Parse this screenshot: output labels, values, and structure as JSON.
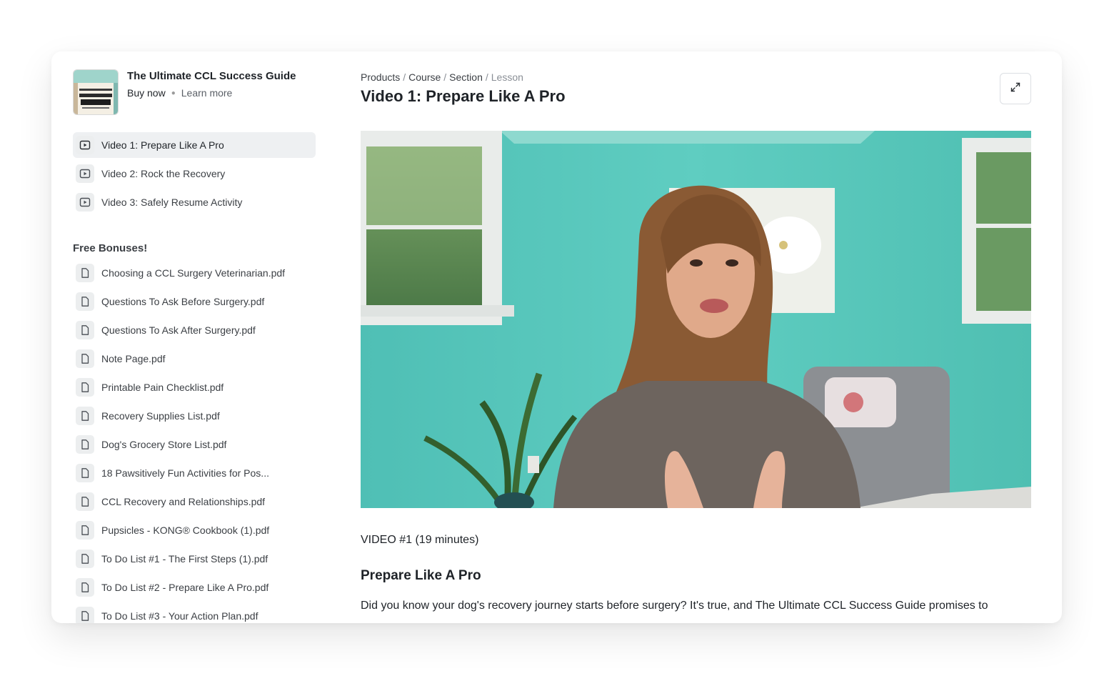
{
  "product": {
    "title": "The Ultimate CCL Success Guide",
    "buy_label": "Buy now",
    "learn_label": "Learn more",
    "thumb_icon": "book-cover-image"
  },
  "lessons": [
    {
      "label": "Video 1: Prepare Like A Pro",
      "active": true,
      "icon": "play-icon"
    },
    {
      "label": "Video 2: Rock the Recovery",
      "active": false,
      "icon": "play-icon"
    },
    {
      "label": "Video 3: Safely Resume Activity",
      "active": false,
      "icon": "play-icon"
    }
  ],
  "bonuses": {
    "heading": "Free Bonuses!",
    "items": [
      {
        "label": "Choosing a CCL Surgery Veterinarian.pdf",
        "icon": "file-icon"
      },
      {
        "label": "Questions To Ask Before Surgery.pdf",
        "icon": "file-icon"
      },
      {
        "label": "Questions To Ask After Surgery.pdf",
        "icon": "file-icon"
      },
      {
        "label": "Note Page.pdf",
        "icon": "file-icon"
      },
      {
        "label": "Printable Pain Checklist.pdf",
        "icon": "file-icon"
      },
      {
        "label": "Recovery Supplies List.pdf",
        "icon": "file-icon"
      },
      {
        "label": "Dog's Grocery Store List.pdf",
        "icon": "file-icon"
      },
      {
        "label": "18 Pawsitively Fun Activities for Pos...",
        "icon": "file-icon"
      },
      {
        "label": "CCL Recovery and Relationships.pdf",
        "icon": "file-icon"
      },
      {
        "label": "Pupsicles - KONG® Cookbook (1).pdf",
        "icon": "file-icon"
      },
      {
        "label": "To Do List #1 - The First Steps (1).pdf",
        "icon": "file-icon"
      },
      {
        "label": "To Do List #2 - Prepare Like A Pro.pdf",
        "icon": "file-icon"
      },
      {
        "label": "To Do List #3 - Your Action Plan.pdf",
        "icon": "file-icon"
      }
    ]
  },
  "breadcrumb": {
    "items": [
      "Products",
      "Course",
      "Section"
    ],
    "current": "Lesson",
    "separator": "/"
  },
  "lesson": {
    "title": "Video 1: Prepare Like A Pro",
    "expand_icon": "expand-icon",
    "video_meta": "VIDEO #1 (19 minutes)",
    "content_heading": "Prepare Like A Pro",
    "content_body": "Did you know your dog's recovery journey starts before surgery? It's true, and The Ultimate CCL Success Guide promises to"
  },
  "colors": {
    "active_bg": "#eef0f2",
    "wall": "#5cc8bc"
  }
}
